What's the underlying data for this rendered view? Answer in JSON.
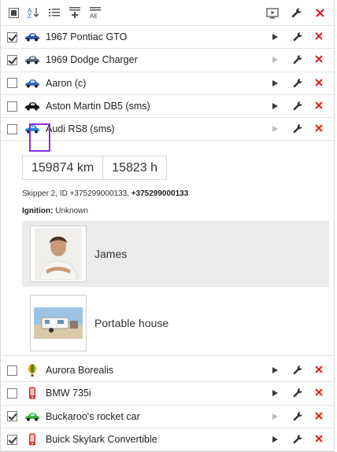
{
  "toolbar": {
    "left_icons": [
      "select-all-checkbox-icon",
      "sort-az-icon",
      "list-icon",
      "add-group-icon",
      "all-icon"
    ],
    "right_icons": [
      "monitor-play-icon",
      "wrench-icon",
      "delete-icon"
    ]
  },
  "units_top": [
    {
      "name": "1967 Pontiac GTO",
      "checked": true,
      "play_enabled": true,
      "icon": "car-icon",
      "color": "#2b5aa6"
    },
    {
      "name": "1969 Dodge Charger",
      "checked": true,
      "play_enabled": false,
      "icon": "car-icon",
      "color": "#5a6a7a"
    },
    {
      "name": "Aaron (c)",
      "checked": false,
      "play_enabled": true,
      "icon": "car-icon",
      "color": "#3b6fb6"
    },
    {
      "name": "Aston Martin DB5 (sms)",
      "checked": false,
      "play_enabled": true,
      "icon": "car-icon",
      "color": "#111111"
    },
    {
      "name": "Audi RS8 (sms)",
      "checked": false,
      "play_enabled": false,
      "icon": "car-icon",
      "color": "#1a8fd8"
    }
  ],
  "details": {
    "mileage": "159874 km",
    "hours": "15823 h",
    "info_prefix": "Skipper 2, ID +375299000133, ",
    "info_bold": "+375299000133",
    "ignition_label": "Ignition:",
    "ignition_value": "Unknown",
    "persons": [
      {
        "label": "James"
      },
      {
        "label": "Portable house"
      }
    ]
  },
  "units_bottom": [
    {
      "name": "Aurora Borealis",
      "checked": false,
      "play_enabled": true,
      "icon": "balloon-icon",
      "color": "#e8a200"
    },
    {
      "name": "BMW 735i",
      "checked": false,
      "play_enabled": true,
      "icon": "phone-icon",
      "color": "#d9332a"
    },
    {
      "name": "Buckaroo's rocket car",
      "checked": true,
      "play_enabled": false,
      "icon": "car-icon",
      "color": "#3bb34a"
    },
    {
      "name": "Buick Skylark Convertible",
      "checked": true,
      "play_enabled": true,
      "icon": "phone-icon",
      "color": "#d9332a"
    }
  ]
}
